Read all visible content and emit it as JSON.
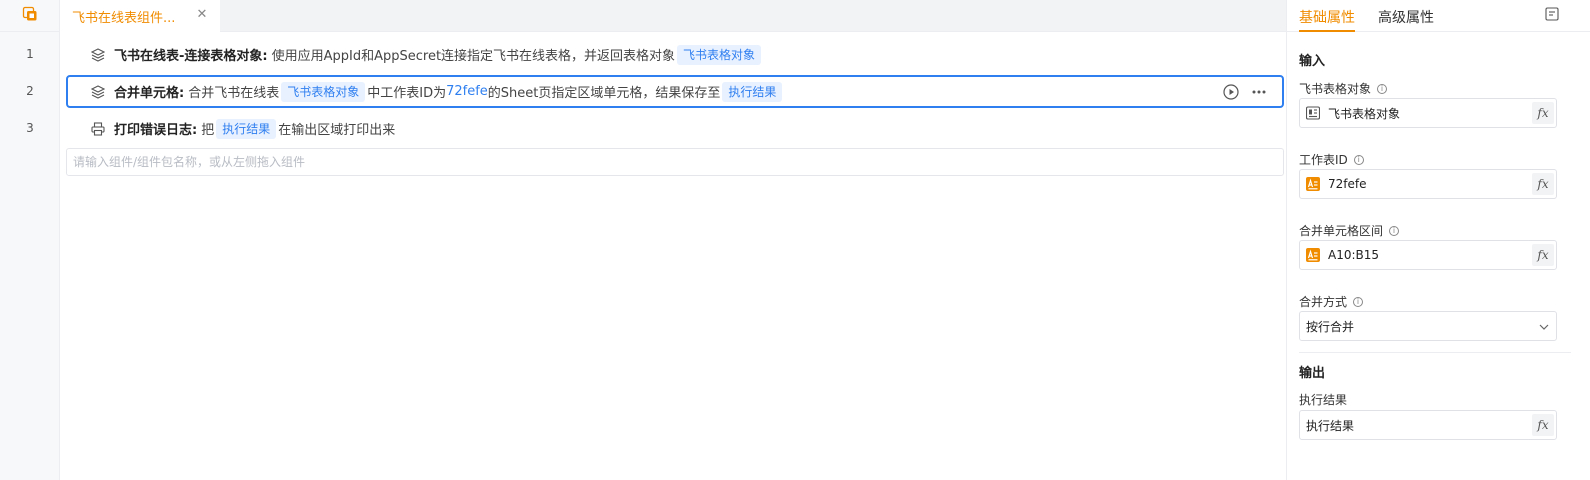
{
  "tab": {
    "label": "飞书在线表组件..."
  },
  "line_numbers": [
    "1",
    "2",
    "3"
  ],
  "steps": [
    {
      "title": "飞书在线表-连接表格对象:",
      "text1": "使用应用AppId和AppSecret连接指定飞书在线表格，并返回表格对象",
      "chip1": "飞书表格对象"
    },
    {
      "title": "合并单元格:",
      "text1": "合并飞书在线表",
      "chip1": "飞书表格对象",
      "text2": "中工作表ID为",
      "highlight": "72fefe",
      "text3": "的Sheet页指定区域单元格，结果保存至",
      "chip2": "执行结果"
    },
    {
      "title": "打印错误日志:",
      "text1": "把",
      "chip1": "执行结果",
      "text2": "在输出区域打印出来"
    }
  ],
  "command_input": {
    "placeholder": "请输入组件/组件包名称，或从左侧拖入组件"
  },
  "panel": {
    "tabs": [
      "基础属性",
      "高级属性"
    ],
    "input_section": "输入",
    "output_section": "输出",
    "fields": [
      {
        "label": "飞书表格对象",
        "value": "飞书表格对象"
      },
      {
        "label": "工作表ID",
        "value": "72fefe"
      },
      {
        "label": "合并单元格区间",
        "value": "A10:B15"
      },
      {
        "label": "合并方式",
        "value": "按行合并"
      }
    ],
    "output_field": {
      "label": "执行结果",
      "value": "执行结果"
    },
    "fx_label": "fx"
  },
  "colors": {
    "accent": "#f08c00",
    "link": "#2f7ff0",
    "chip_bg": "#e8f1ff"
  }
}
